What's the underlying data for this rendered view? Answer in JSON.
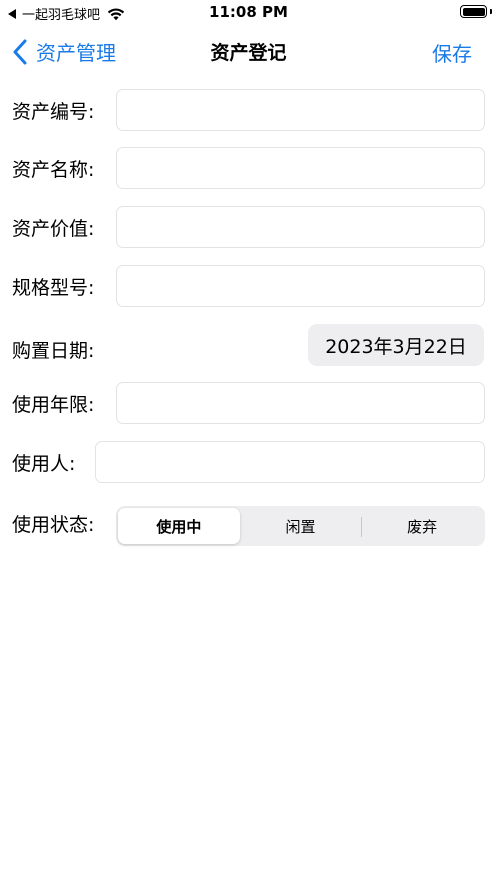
{
  "status_bar": {
    "carrier": "一起羽毛球吧",
    "time": "11:08 PM"
  },
  "nav": {
    "back_label": "资产管理",
    "title": "资产登记",
    "save_label": "保存"
  },
  "form": {
    "asset_number": {
      "label": "资产编号:",
      "value": "",
      "placeholder": ""
    },
    "asset_name": {
      "label": "资产名称:",
      "value": "",
      "placeholder": ""
    },
    "asset_value": {
      "label": "资产价值:",
      "value": "",
      "placeholder": ""
    },
    "model": {
      "label": "规格型号:",
      "value": "",
      "placeholder": ""
    },
    "purchase_date": {
      "label": "购置日期:",
      "value": "2023年3月22日"
    },
    "service_life": {
      "label": "使用年限:",
      "value": "",
      "placeholder": ""
    },
    "user": {
      "label": "使用人:",
      "value": "",
      "placeholder": ""
    },
    "status": {
      "label": "使用状态:",
      "options": [
        "使用中",
        "闲置",
        "废弃"
      ],
      "selected": "使用中"
    }
  },
  "colors": {
    "accent": "#1a7ae8",
    "field_border": "#e3e3e6",
    "segment_bg": "#eeeef0"
  }
}
